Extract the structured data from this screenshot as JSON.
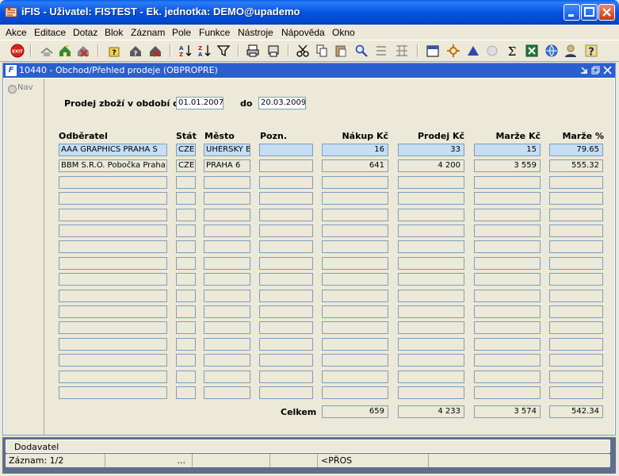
{
  "window": {
    "title": "iFIS - Uživatel: FISTEST - Ek. jednotka: DEMO@upademo"
  },
  "menu": [
    "Akce",
    "Editace",
    "Dotaz",
    "Blok",
    "Záznam",
    "Pole",
    "Funkce",
    "Nástroje",
    "Nápověda",
    "Okno"
  ],
  "toolbar": {
    "exit_label": "EXIT",
    "sum_symbol": "Σ",
    "help_symbol": "?"
  },
  "form_window": {
    "title": "10440 - Obchod/Přehled prodeje (OBPROPRE)"
  },
  "nav": {
    "label": "Nav"
  },
  "filter": {
    "period_label": "Prodej zboží v období od",
    "date_from": "01.01.2007",
    "to_label": "do",
    "date_to": "20.03.2009"
  },
  "table": {
    "columns": [
      "Odběratel",
      "Stát",
      "Město",
      "Pozn.",
      "Nákup Kč",
      "Prodej Kč",
      "Marže Kč",
      "Marže %"
    ],
    "rows": [
      {
        "customer": "AAA GRAPHICS PRAHA S",
        "state": "CZE",
        "city": "UHERSKY B",
        "note": "",
        "purchase": "16",
        "sale": "33",
        "margin": "15",
        "margin_pct": "79.65"
      },
      {
        "customer": "BBM S.R.O. Pobočka Praha",
        "state": "CZE",
        "city": "PRAHA 6",
        "note": "",
        "purchase": "641",
        "sale": "4 200",
        "margin": "3 559",
        "margin_pct": "555.32"
      }
    ],
    "empty_rows": 14
  },
  "totals": {
    "label": "Celkem",
    "purchase": "659",
    "sale": "4 233",
    "margin": "3 574",
    "margin_pct": "542.34"
  },
  "status": {
    "block": "Dodavatel",
    "record": "Záznam: 1/2",
    "ellipsis": "...",
    "mode": "<PŘOS"
  },
  "colors": {
    "titlebar": "#0654E0",
    "selected_row": "#C5DDF5",
    "form_bg": "#ECE9D8"
  }
}
